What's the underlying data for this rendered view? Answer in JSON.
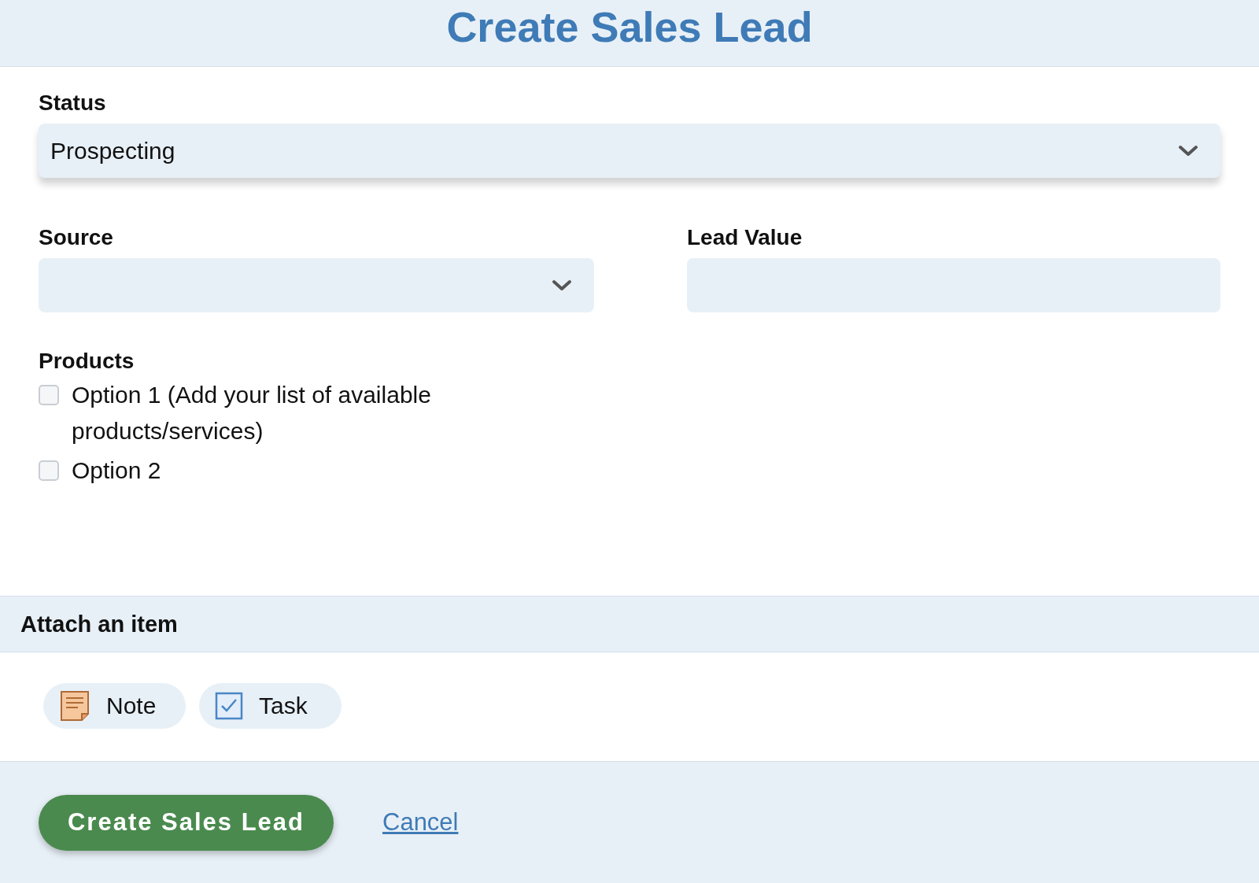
{
  "title": "Create Sales Lead",
  "status": {
    "label": "Status",
    "value": "Prospecting"
  },
  "source": {
    "label": "Source"
  },
  "lead_value": {
    "label": "Lead Value"
  },
  "products": {
    "label": "Products",
    "options": [
      {
        "label": "Option 1 (Add your list of available products/services)",
        "checked": false
      },
      {
        "label": "Option 2",
        "checked": false
      }
    ]
  },
  "attach": {
    "title": "Attach an item",
    "items": [
      {
        "label": "Note",
        "kind": "note"
      },
      {
        "label": "Task",
        "kind": "task"
      }
    ]
  },
  "actions": {
    "submit": "Create Sales Lead",
    "cancel": "Cancel"
  }
}
